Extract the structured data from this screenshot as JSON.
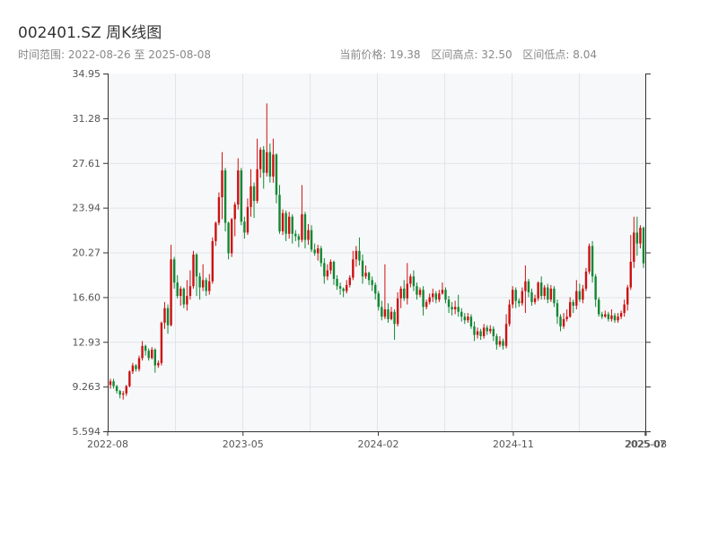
{
  "header": {
    "title": "002401.SZ 周K线图",
    "range": "时间范围: 2022-08-26 至 2025-08-08",
    "price": "当前价格: 19.38",
    "high": "区间高点: 32.50",
    "low": "区间低点: 8.04"
  },
  "colors": {
    "up": "#cc1111",
    "down": "#118833",
    "plot_bg": "#f7f8fa",
    "grid": "#e2e4e8",
    "axis": "#333333"
  },
  "chart_data": {
    "type": "candlestick",
    "ylim": [
      5.594,
      34.95
    ],
    "y_ticks": [
      "5.594",
      "9.263",
      "12.93",
      "16.60",
      "20.27",
      "23.94",
      "27.61",
      "31.28",
      "34.95"
    ],
    "x_ticks": [
      {
        "label": "2022-08",
        "t": 0
      },
      {
        "label": "2023-05",
        "t": 39.2
      },
      {
        "label": "2024-02",
        "t": 78.4
      },
      {
        "label": "2024-11",
        "t": 117.5
      },
      {
        "label": "2025-07",
        "t": 155.7
      },
      {
        "label": "2025-08",
        "t": 156
      }
    ],
    "x_range": [
      0,
      156
    ],
    "grid": true,
    "candles": [
      [
        9.4,
        9.7,
        9.1,
        9.9
      ],
      [
        9.7,
        9.3,
        9.1,
        9.9
      ],
      [
        9.3,
        8.9,
        8.7,
        9.4
      ],
      [
        8.9,
        8.6,
        8.3,
        9.0
      ],
      [
        8.6,
        8.7,
        8.2,
        8.9
      ],
      [
        8.7,
        9.3,
        8.5,
        9.4
      ],
      [
        9.3,
        10.5,
        9.2,
        10.6
      ],
      [
        10.5,
        11.0,
        10.3,
        11.2
      ],
      [
        11.0,
        10.7,
        10.5,
        11.1
      ],
      [
        10.7,
        11.6,
        10.5,
        11.8
      ],
      [
        11.6,
        12.6,
        11.4,
        13.0
      ],
      [
        12.6,
        12.2,
        11.8,
        12.7
      ],
      [
        12.2,
        11.6,
        11.4,
        12.4
      ],
      [
        11.6,
        12.3,
        11.5,
        12.5
      ],
      [
        12.3,
        11.0,
        10.4,
        12.4
      ],
      [
        11.0,
        11.2,
        10.8,
        11.4
      ],
      [
        11.2,
        14.5,
        11.0,
        14.6
      ],
      [
        14.5,
        15.7,
        14.0,
        16.2
      ],
      [
        15.7,
        14.3,
        13.6,
        16.0
      ],
      [
        14.3,
        19.7,
        14.2,
        20.9
      ],
      [
        19.7,
        17.8,
        17.3,
        19.9
      ],
      [
        17.8,
        16.7,
        16.5,
        18.4
      ],
      [
        16.7,
        17.3,
        15.9,
        17.5
      ],
      [
        17.3,
        16.0,
        15.7,
        17.4
      ],
      [
        16.0,
        16.7,
        15.5,
        18.0
      ],
      [
        16.7,
        17.5,
        16.4,
        18.8
      ],
      [
        17.5,
        20.1,
        17.3,
        20.4
      ],
      [
        20.1,
        18.3,
        16.7,
        20.2
      ],
      [
        18.3,
        17.4,
        16.4,
        18.6
      ],
      [
        17.4,
        18.0,
        17.1,
        19.3
      ],
      [
        18.0,
        17.1,
        16.7,
        18.2
      ],
      [
        17.1,
        17.9,
        16.8,
        18.5
      ],
      [
        17.9,
        21.2,
        17.7,
        21.5
      ],
      [
        21.2,
        22.7,
        20.8,
        22.8
      ],
      [
        22.7,
        24.8,
        22.5,
        25.2
      ],
      [
        24.8,
        27.0,
        23.0,
        28.5
      ],
      [
        27.0,
        22.7,
        22.0,
        27.2
      ],
      [
        22.7,
        20.2,
        19.7,
        22.8
      ],
      [
        20.2,
        23.0,
        19.9,
        23.1
      ],
      [
        23.0,
        24.2,
        21.6,
        24.4
      ],
      [
        24.2,
        27.0,
        23.8,
        28.0
      ],
      [
        27.0,
        22.8,
        22.5,
        27.2
      ],
      [
        22.8,
        21.9,
        21.4,
        23.2
      ],
      [
        21.9,
        24.0,
        21.7,
        24.7
      ],
      [
        24.0,
        25.7,
        23.2,
        27.1
      ],
      [
        25.7,
        24.5,
        23.1,
        26.0
      ],
      [
        24.5,
        27.1,
        24.3,
        29.6
      ],
      [
        27.1,
        28.7,
        26.4,
        28.9
      ],
      [
        28.7,
        26.8,
        25.5,
        29.0
      ],
      [
        26.8,
        28.5,
        26.5,
        32.5
      ],
      [
        28.5,
        26.5,
        26.0,
        29.2
      ],
      [
        26.5,
        28.3,
        26.0,
        29.6
      ],
      [
        28.3,
        25.0,
        24.3,
        28.4
      ],
      [
        25.0,
        22.0,
        21.8,
        25.8
      ],
      [
        22.0,
        23.5,
        21.7,
        23.8
      ],
      [
        23.5,
        21.8,
        21.2,
        23.7
      ],
      [
        21.8,
        23.2,
        21.4,
        23.6
      ],
      [
        23.2,
        21.8,
        21.0,
        23.4
      ],
      [
        21.8,
        21.6,
        21.2,
        22.1
      ],
      [
        21.6,
        21.3,
        20.7,
        21.8
      ],
      [
        21.3,
        23.4,
        21.1,
        25.8
      ],
      [
        23.4,
        21.3,
        20.6,
        23.6
      ],
      [
        21.3,
        22.1,
        20.9,
        22.6
      ],
      [
        22.1,
        20.5,
        20.3,
        22.5
      ],
      [
        20.5,
        20.2,
        20.0,
        21.0
      ],
      [
        20.2,
        20.6,
        19.6,
        20.9
      ],
      [
        20.6,
        19.4,
        19.1,
        20.8
      ],
      [
        19.4,
        18.3,
        17.7,
        19.8
      ],
      [
        18.3,
        18.8,
        18.0,
        19.3
      ],
      [
        18.8,
        19.5,
        18.5,
        19.7
      ],
      [
        19.5,
        18.1,
        17.6,
        19.6
      ],
      [
        18.1,
        17.5,
        17.2,
        18.4
      ],
      [
        17.5,
        17.3,
        16.8,
        17.8
      ],
      [
        17.3,
        17.1,
        16.6,
        17.4
      ],
      [
        17.1,
        17.6,
        16.9,
        18.0
      ],
      [
        17.6,
        18.2,
        17.4,
        18.4
      ],
      [
        18.2,
        19.7,
        18.0,
        20.4
      ],
      [
        19.7,
        20.4,
        19.1,
        20.8
      ],
      [
        20.4,
        19.6,
        19.2,
        21.5
      ],
      [
        19.6,
        18.3,
        17.7,
        20.1
      ],
      [
        18.3,
        18.6,
        18.1,
        19.2
      ],
      [
        18.6,
        18.0,
        17.6,
        18.7
      ],
      [
        18.0,
        17.6,
        17.1,
        18.3
      ],
      [
        17.6,
        16.9,
        16.4,
        17.8
      ],
      [
        16.9,
        15.8,
        15.5,
        17.1
      ],
      [
        15.8,
        15.0,
        14.7,
        16.3
      ],
      [
        15.0,
        15.6,
        14.8,
        19.3
      ],
      [
        15.6,
        14.8,
        14.5,
        16.1
      ],
      [
        14.8,
        15.4,
        14.7,
        15.8
      ],
      [
        15.4,
        14.4,
        13.1,
        15.6
      ],
      [
        14.4,
        16.5,
        14.2,
        17.0
      ],
      [
        16.5,
        17.3,
        15.7,
        17.5
      ],
      [
        17.3,
        16.5,
        16.3,
        18.0
      ],
      [
        16.5,
        17.7,
        16.0,
        19.4
      ],
      [
        17.7,
        18.3,
        17.4,
        18.5
      ],
      [
        18.3,
        17.5,
        17.1,
        18.8
      ],
      [
        17.5,
        16.8,
        16.4,
        17.8
      ],
      [
        16.8,
        17.2,
        16.6,
        17.4
      ],
      [
        17.2,
        15.8,
        15.1,
        17.5
      ],
      [
        15.8,
        16.2,
        15.6,
        16.4
      ],
      [
        16.2,
        16.6,
        16.0,
        16.9
      ],
      [
        16.6,
        16.9,
        16.2,
        17.3
      ],
      [
        16.9,
        16.4,
        16.1,
        17.1
      ],
      [
        16.4,
        16.9,
        16.2,
        17.2
      ],
      [
        16.9,
        17.2,
        16.8,
        17.8
      ],
      [
        17.2,
        16.4,
        16.1,
        17.4
      ],
      [
        16.4,
        15.8,
        15.3,
        16.7
      ],
      [
        15.8,
        15.6,
        15.1,
        16.2
      ],
      [
        15.6,
        15.8,
        15.2,
        16.3
      ],
      [
        15.8,
        15.4,
        15.0,
        16.8
      ],
      [
        15.4,
        15.0,
        14.6,
        15.7
      ],
      [
        15.0,
        14.7,
        14.4,
        15.3
      ],
      [
        14.7,
        15.0,
        14.5,
        15.3
      ],
      [
        15.0,
        14.2,
        14.0,
        15.2
      ],
      [
        14.2,
        13.5,
        13.0,
        14.6
      ],
      [
        13.5,
        13.8,
        13.2,
        14.1
      ],
      [
        13.8,
        13.4,
        13.1,
        14.0
      ],
      [
        13.4,
        14.1,
        13.2,
        14.4
      ],
      [
        14.1,
        13.8,
        13.5,
        14.3
      ],
      [
        13.8,
        14.0,
        13.6,
        14.3
      ],
      [
        14.0,
        13.4,
        13.0,
        14.2
      ],
      [
        13.4,
        12.7,
        12.3,
        13.6
      ],
      [
        12.7,
        13.0,
        12.5,
        13.4
      ],
      [
        13.0,
        12.6,
        12.3,
        13.2
      ],
      [
        12.6,
        14.4,
        12.4,
        15.2
      ],
      [
        14.4,
        16.0,
        14.2,
        16.4
      ],
      [
        16.0,
        17.2,
        15.7,
        17.5
      ],
      [
        17.2,
        16.3,
        15.7,
        17.4
      ],
      [
        16.3,
        16.1,
        15.8,
        16.5
      ],
      [
        16.1,
        17.1,
        15.9,
        17.4
      ],
      [
        17.1,
        17.9,
        15.3,
        19.2
      ],
      [
        17.9,
        17.0,
        16.6,
        18.1
      ],
      [
        17.0,
        16.2,
        15.9,
        17.3
      ],
      [
        16.2,
        16.5,
        16.0,
        16.8
      ],
      [
        16.5,
        17.8,
        16.3,
        17.9
      ],
      [
        17.8,
        16.7,
        16.4,
        18.3
      ],
      [
        16.7,
        17.4,
        16.4,
        17.6
      ],
      [
        17.4,
        16.4,
        16.1,
        17.7
      ],
      [
        16.4,
        17.3,
        16.2,
        17.6
      ],
      [
        17.3,
        16.1,
        15.8,
        17.5
      ],
      [
        16.1,
        15.0,
        14.4,
        16.4
      ],
      [
        15.0,
        14.2,
        13.8,
        15.2
      ],
      [
        14.2,
        14.8,
        14.0,
        15.3
      ],
      [
        14.8,
        15.0,
        14.6,
        15.6
      ],
      [
        15.0,
        16.2,
        14.9,
        16.6
      ],
      [
        16.2,
        15.9,
        15.3,
        16.4
      ],
      [
        15.9,
        17.1,
        15.6,
        18.0
      ],
      [
        17.1,
        16.4,
        16.2,
        17.7
      ],
      [
        16.4,
        17.3,
        16.1,
        17.6
      ],
      [
        17.3,
        18.7,
        17.1,
        19.0
      ],
      [
        18.7,
        20.8,
        18.5,
        21.0
      ],
      [
        20.8,
        18.3,
        17.8,
        21.2
      ],
      [
        18.3,
        16.4,
        15.8,
        18.5
      ],
      [
        16.4,
        15.2,
        15.0,
        16.6
      ],
      [
        15.2,
        15.0,
        14.8,
        15.4
      ],
      [
        15.0,
        15.2,
        14.9,
        15.5
      ],
      [
        15.2,
        14.8,
        14.6,
        15.4
      ],
      [
        14.8,
        15.1,
        14.6,
        15.6
      ],
      [
        15.1,
        14.7,
        14.5,
        15.3
      ],
      [
        14.7,
        15.0,
        14.5,
        15.3
      ],
      [
        15.0,
        15.3,
        14.8,
        15.5
      ],
      [
        15.3,
        16.0,
        15.0,
        16.4
      ],
      [
        16.0,
        17.4,
        15.5,
        17.6
      ],
      [
        17.4,
        19.5,
        17.2,
        21.7
      ],
      [
        19.5,
        21.9,
        19.0,
        23.2
      ],
      [
        21.9,
        21.0,
        20.0,
        23.2
      ],
      [
        21.0,
        22.3,
        20.6,
        22.5
      ],
      [
        22.3,
        19.38,
        19.0,
        22.4
      ]
    ]
  }
}
